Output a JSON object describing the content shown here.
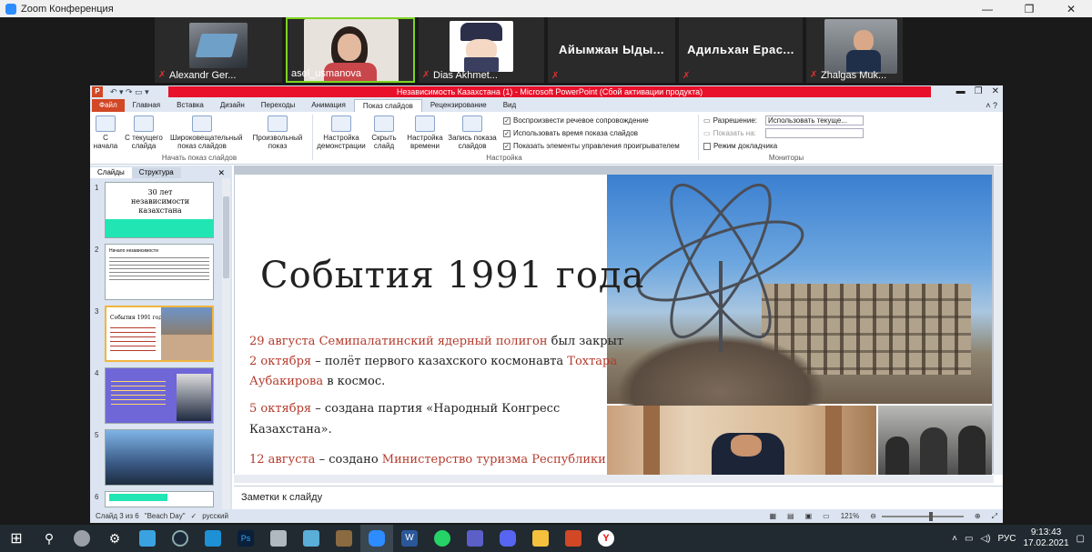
{
  "window": {
    "title": "Zoom Конференция",
    "controls": [
      "—",
      "❐",
      "✕"
    ]
  },
  "participants": [
    {
      "name": "Alexandr Ger...",
      "muted": true
    },
    {
      "name": "asel_usmanova",
      "muted": false
    },
    {
      "name": "Dias Akhmet...",
      "muted": true
    },
    {
      "name": "Айымжан Ыды...",
      "muted": true
    },
    {
      "name": "Адильхан Ерас...",
      "muted": true
    },
    {
      "name": "Zhalgas Muk...",
      "muted": true
    }
  ],
  "ppt": {
    "title": "Независимость Казахстана (1) - Microsoft PowerPoint (Сбой активации продукта)",
    "app_icon": "P",
    "tabs": [
      "Файл",
      "Главная",
      "Вставка",
      "Дизайн",
      "Переходы",
      "Анимация",
      "Показ слайдов",
      "Рецензирование",
      "Вид"
    ],
    "ribbon": {
      "buttons": [
        "С начала",
        "С текущего слайда",
        "Широковещательный показ слайдов",
        "Произвольный показ",
        "Настройка демонстрации",
        "Скрыть слайд",
        "Настройка времени",
        "Запись показа слайдов"
      ],
      "group_start": "Начать показ слайдов",
      "group_setup": "Настройка",
      "group_monitors": "Мониторы",
      "checks": [
        "Воспроизвести речевое сопровождение",
        "Использовать время показа слайдов",
        "Показать элементы управления проигрывателем"
      ],
      "resolution_label": "Разрешение:",
      "resolution_value": "Использовать текуще...",
      "show_on_label": "Показать на:",
      "presenter_view": "Режим докладчика"
    },
    "pane": {
      "tab_slides": "Слайды",
      "tab_outline": "Структура",
      "close": "✕",
      "thumbs": [
        {
          "num": "1",
          "title": "30 лет независимости казахстана"
        },
        {
          "num": "2",
          "title": "Начало независимости"
        },
        {
          "num": "3",
          "title": "События 1991 года"
        },
        {
          "num": "4",
          "title": ""
        },
        {
          "num": "5",
          "title": ""
        },
        {
          "num": "6",
          "title": ""
        }
      ]
    },
    "slide": {
      "title": "События 1991 года",
      "l1a": "29 августа ",
      "l1b": "Семипалатинский ядерный полигон",
      "l1c": " был закрыт",
      "l2a": "2 октября",
      "l2b": " – полёт первого казахского космонавта ",
      "l2c": "Тохтара",
      "l3a": "Аубакирова",
      "l3b": " в космос.",
      "l4a": "5 октября",
      "l4b": " – создана партия «Народный Конгресс",
      "l5": "Казахстана».",
      "l6a": "12 августа",
      "l6b": " – создано ",
      "l6c": "Министерство туризма Республики"
    },
    "notes_placeholder": "Заметки к слайду",
    "status": {
      "slide": "Слайд 3 из 6",
      "theme": "\"Beach Day\"",
      "lang": "русский",
      "zoom": "121%"
    }
  },
  "taskbar": {
    "lang": "РУС",
    "time": "9:13:43",
    "date": "17.02.2021"
  },
  "colors": {
    "accent_red": "#e8102a",
    "slide_red": "#b43a2c",
    "ppt_orange": "#d24726"
  }
}
